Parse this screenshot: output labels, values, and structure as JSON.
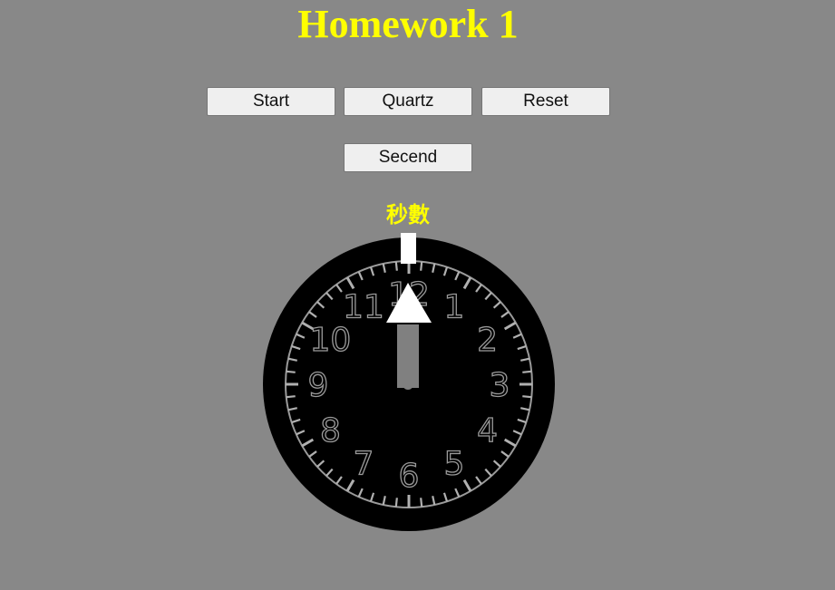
{
  "header": {
    "title": "Homework 1"
  },
  "controls": {
    "start_label": "Start",
    "quartz_label": "Quartz",
    "reset_label": "Reset",
    "secend_label": "Secend"
  },
  "clock": {
    "label": "秒數",
    "numerals": [
      "12",
      "1",
      "2",
      "3",
      "4",
      "5",
      "6",
      "7",
      "8",
      "9",
      "10",
      "11"
    ],
    "hand_icon": "arrow-up-icon",
    "hand_position_seconds": 0
  },
  "colors": {
    "background": "#888888",
    "accent": "#ffff00",
    "dial": "#000000",
    "hand": "#ffffff"
  }
}
